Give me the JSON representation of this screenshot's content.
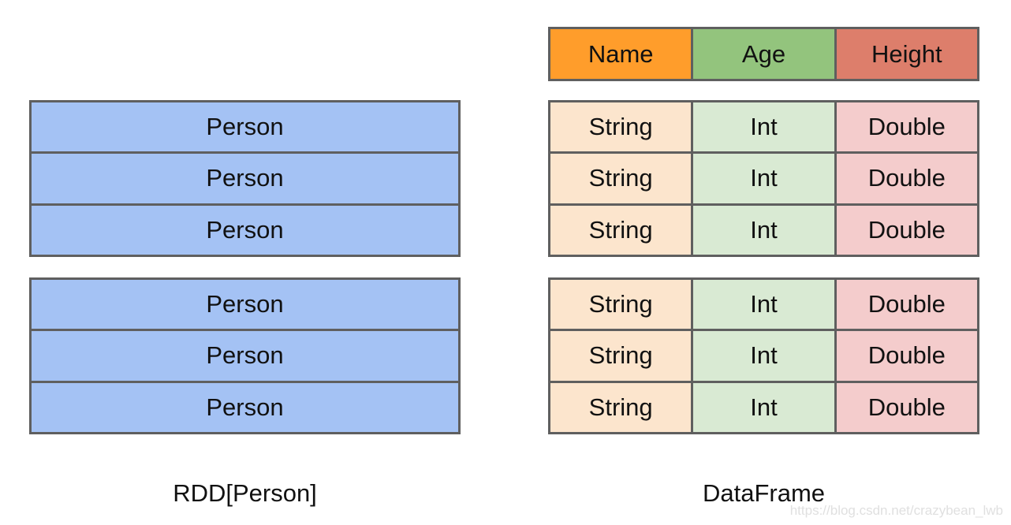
{
  "rdd": {
    "label": "RDD[Person]",
    "color": "#a4c2f4",
    "groups": [
      [
        "Person",
        "Person",
        "Person"
      ],
      [
        "Person",
        "Person",
        "Person"
      ]
    ]
  },
  "dataframe": {
    "label": "DataFrame",
    "header": [
      "Name",
      "Age",
      "Height"
    ],
    "header_colors": [
      "#ff9d2b",
      "#93c47d",
      "#dd7e6b"
    ],
    "groups": [
      [
        [
          "String",
          "Int",
          "Double"
        ],
        [
          "String",
          "Int",
          "Double"
        ],
        [
          "String",
          "Int",
          "Double"
        ]
      ],
      [
        [
          "String",
          "Int",
          "Double"
        ],
        [
          "String",
          "Int",
          "Double"
        ],
        [
          "String",
          "Int",
          "Double"
        ]
      ]
    ]
  },
  "watermark": "https://blog.csdn.net/crazybean_lwb"
}
